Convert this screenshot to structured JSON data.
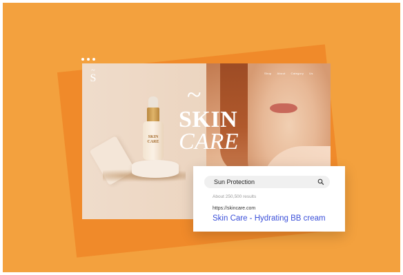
{
  "brand": {
    "logo_letter": "S",
    "logo_mark": "~"
  },
  "nav": {
    "items": [
      "Shop",
      "About",
      "Category",
      "Us"
    ]
  },
  "hero": {
    "title_mark": "~",
    "title_line1": "SKIN",
    "title_line2": "CARE"
  },
  "product": {
    "label_line1": "SKIN",
    "label_line2": "CARE"
  },
  "search": {
    "query": "Sun Protection",
    "icon": "search-icon",
    "result_count": "About 250,500 results",
    "result_url": "https://skincare.com",
    "result_title": "Skin Care - Hydrating BB cream"
  },
  "colors": {
    "background": "#f3a13e",
    "back_card": "#f08a2a",
    "link": "#3a4fd9"
  }
}
